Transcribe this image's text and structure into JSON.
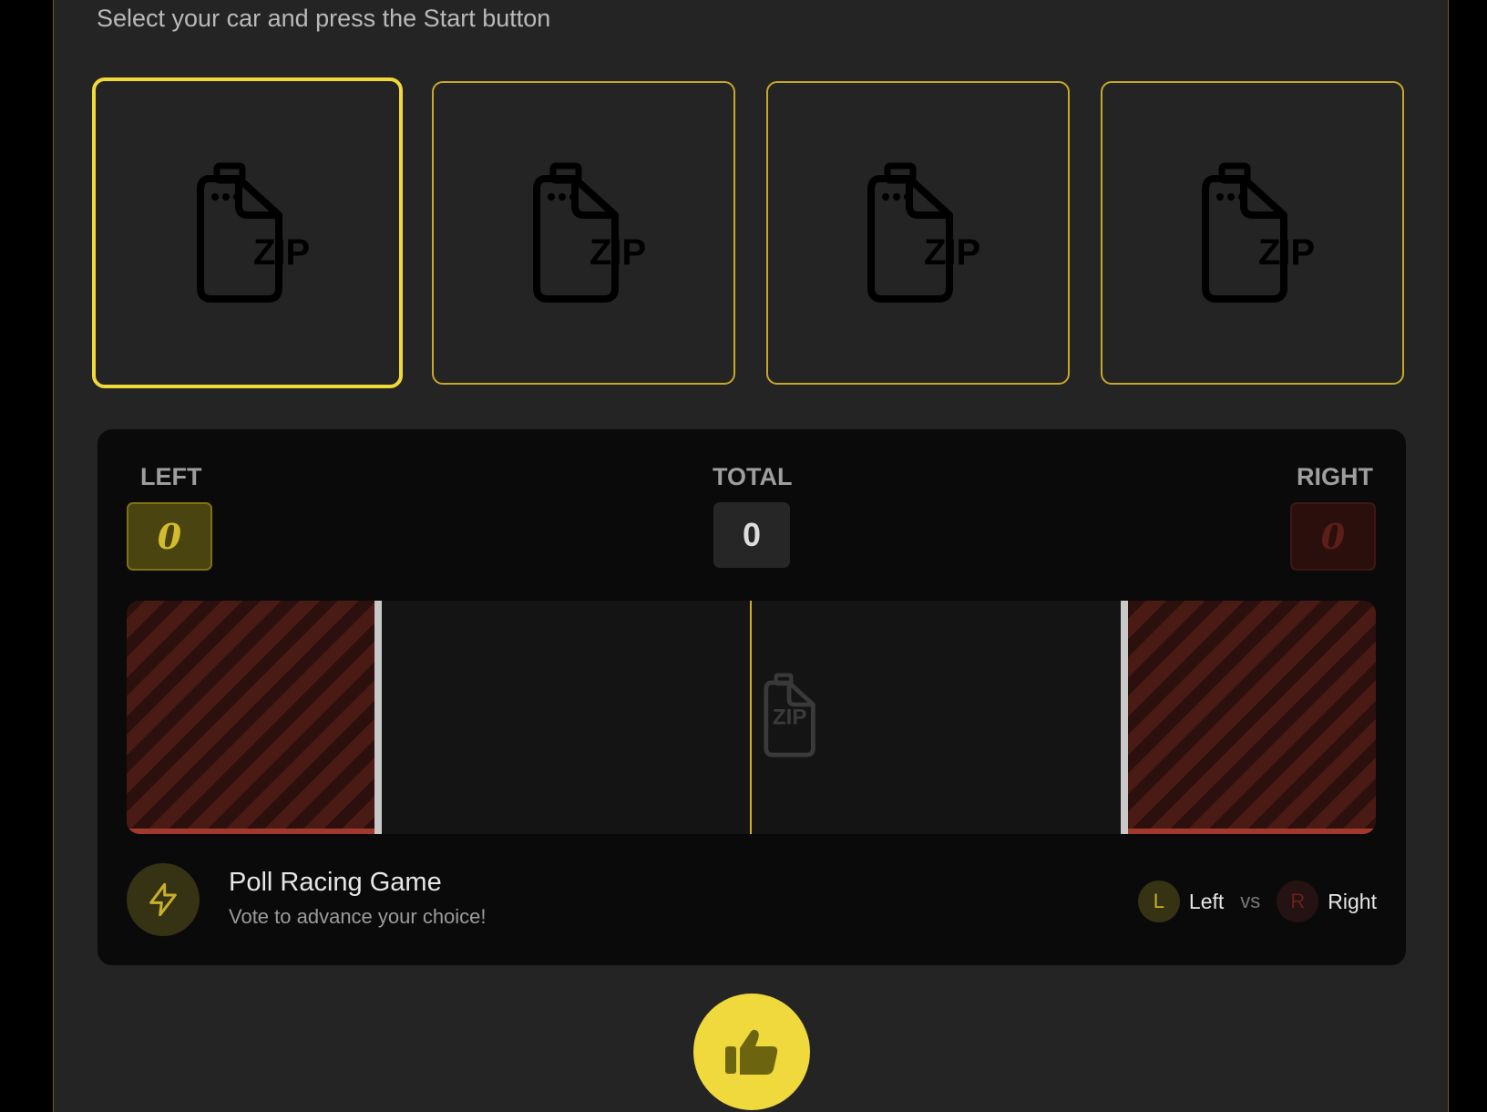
{
  "instruction": "Select your car and press the Start button",
  "cars": [
    {
      "icon": "zip-file-icon",
      "badge": "ZIP",
      "selected": true
    },
    {
      "icon": "zip-file-icon",
      "badge": "ZIP",
      "selected": false
    },
    {
      "icon": "zip-file-icon",
      "badge": "ZIP",
      "selected": false
    },
    {
      "icon": "zip-file-icon",
      "badge": "ZIP",
      "selected": false
    }
  ],
  "scoreboard": {
    "left_label": "LEFT",
    "left_value": "0",
    "total_label": "TOTAL",
    "total_value": "0",
    "right_label": "RIGHT",
    "right_value": "0"
  },
  "track": {
    "car_icon": "zip-file-icon",
    "car_badge": "ZIP"
  },
  "game": {
    "badge_icon": "lightning-bolt-icon",
    "title": "Poll Racing Game",
    "subtitle": "Vote to advance your choice!"
  },
  "legend": {
    "left_chip": "L",
    "left_label": "Left",
    "vs": "vs",
    "right_chip": "R",
    "right_label": "Right"
  },
  "vote_button": {
    "icon": "thumbs-up-icon"
  },
  "colors": {
    "accent": "#efd93c",
    "left_team": "#d2bb2c",
    "right_team": "#a2392d",
    "panel_bg": "#242424",
    "game_bg": "#0a0a0a"
  }
}
